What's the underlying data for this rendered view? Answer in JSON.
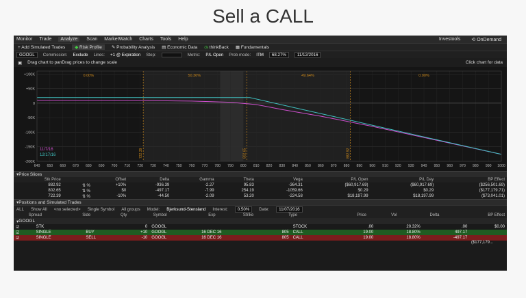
{
  "slide_title": "Sell a CALL",
  "menu": {
    "items": [
      "Monitor",
      "Trade",
      "Analyze",
      "Scan",
      "MarketWatch",
      "Charts",
      "Tools",
      "Help"
    ],
    "active": "Analyze",
    "right": [
      "Investools",
      "OnDemand"
    ]
  },
  "subtabs": [
    "Add Simulated Trades",
    "Risk Profile",
    "Probability Analysis",
    "Economic Data",
    "thinkBack",
    "Fundamentals"
  ],
  "controls": {
    "symbol": "GOOGL",
    "commission_label": "Commission:",
    "commission_value": "Exclude",
    "lines_label": "Lines:",
    "lines_value": "+1 @ Expiration",
    "step_label": "Step:",
    "metric_label": "Metric:",
    "metric_value": "P/L Open",
    "prob_label": "Prob mode:",
    "prob_value": "ITM",
    "pct": "68.27%",
    "date": "11/12/2016"
  },
  "chart_header": {
    "left": "Drag chart to panDrag prices to change scale",
    "right": "Click chart for data"
  },
  "chart_data": {
    "type": "line",
    "x_ticks": [
      640,
      650,
      660,
      670,
      680,
      690,
      700,
      710,
      720,
      730,
      740,
      750,
      760,
      770,
      780,
      790,
      800,
      810,
      820,
      830,
      840,
      850,
      860,
      870,
      880,
      890,
      900,
      910,
      920,
      930,
      940,
      950,
      960,
      970,
      980,
      990,
      1000
    ],
    "y_ticks": [
      "+100K",
      "+50K",
      "0",
      "-50K",
      "-100K",
      "-150K",
      "-200K"
    ],
    "y_values": [
      100000,
      50000,
      0,
      -50000,
      -100000,
      -150000,
      -200000
    ],
    "xlim": [
      640,
      1000
    ],
    "ylim": [
      -200000,
      110000
    ],
    "zone_labels": [
      "0.00%",
      "50.36%",
      "49.64%",
      "0.00%"
    ],
    "vlines": [
      {
        "x": 722.39,
        "label": "722.39"
      },
      {
        "x": 802.65,
        "label": "802.65"
      },
      {
        "x": 882.92,
        "label": "882.92"
      }
    ],
    "series": [
      {
        "name": "11/7/16",
        "color": "#d050d0",
        "points": [
          [
            640,
            10000
          ],
          [
            720,
            9000
          ],
          [
            760,
            7000
          ],
          [
            790,
            3000
          ],
          [
            810,
            -5000
          ],
          [
            830,
            -22000
          ],
          [
            860,
            -45000
          ],
          [
            900,
            -80000
          ],
          [
            950,
            -128000
          ],
          [
            1000,
            -176000
          ]
        ]
      },
      {
        "name": "12/17/16",
        "color": "#40c0c0",
        "points": [
          [
            640,
            19000
          ],
          [
            805,
            19000
          ],
          [
            840,
            -16000
          ],
          [
            900,
            -76000
          ],
          [
            950,
            -126000
          ],
          [
            1000,
            -176000
          ]
        ]
      }
    ]
  },
  "price_slices": {
    "section_title": "Price Slices",
    "headers": [
      "Stk Price",
      "",
      "Offset",
      "Delta",
      "Gamma",
      "Theta",
      "Vega",
      "P/L Open",
      "P/L Day",
      "BP Effect"
    ],
    "rows": [
      [
        "882.92",
        "",
        "+10%",
        "-936.39",
        "-2.27",
        "95.83",
        "-364.31",
        "($60,917.69)",
        "($60,917.69)",
        "($256,501.69)"
      ],
      [
        "802.65",
        "",
        "$0",
        "-497.17",
        "-7.99",
        "254.19",
        "-1059.66",
        "$0.29",
        "$0.29",
        "($177,179.71)"
      ],
      [
        "722.39",
        "",
        "-10%",
        "-44.50",
        "-2.09",
        "53.20",
        "-224.58",
        "$18,197.99",
        "$18,197.99",
        "($73,041.01)"
      ]
    ]
  },
  "positions": {
    "section_title": "Positions and Simulated Trades",
    "filter": {
      "all": "ALL",
      "show": "Show All",
      "selected": "<no selected>",
      "symbol_mode": "Single Symbol",
      "groups": "All groups",
      "model_label": "Model:",
      "model_value": "Bjerksund-Stensland",
      "interest_label": "Interest:",
      "interest_value": "0.50%",
      "date_label": "Date:",
      "date_value": "11/07/2016"
    },
    "headers": [
      "Spread",
      "Side",
      "Qty",
      "Symbol",
      "Exp",
      "Strike",
      "Type",
      "Price",
      "Vol",
      "Delta",
      "BP Effect"
    ],
    "group": "GOOGL",
    "rows": [
      [
        "STK",
        "",
        "0",
        "GOOGL",
        "",
        "",
        "STOCK",
        ".00",
        "20.32%",
        ".00",
        "$0.00"
      ],
      [
        "SINGLE",
        "BUY",
        "+10",
        "GOOGL",
        "16 DEC 16",
        "805",
        "CALL",
        "19.00",
        "18.80%",
        "497.17",
        ""
      ],
      [
        "SINGLE",
        "SELL",
        "-10",
        "GOOGL",
        "16 DEC 16",
        "805",
        "CALL",
        "19.00",
        "18.80%",
        "-497.17",
        ""
      ]
    ],
    "total": "($177,179..."
  }
}
